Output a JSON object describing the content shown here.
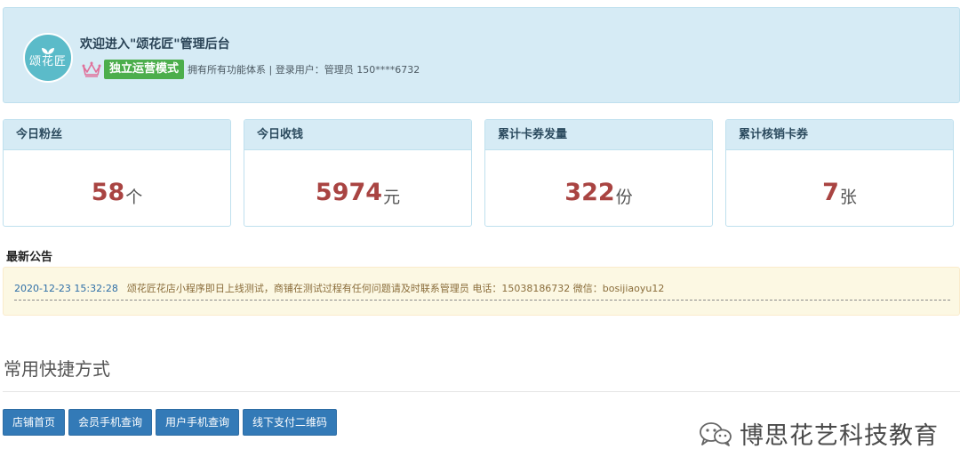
{
  "header": {
    "logo_text": "颂花匠",
    "welcome": "欢迎进入\"颂花匠\"管理后台",
    "mode_badge": "独立运营模式",
    "sub_info": "拥有所有功能体系 | 登录用户：管理员 150****6732"
  },
  "stats": [
    {
      "label": "今日粉丝",
      "value": "58",
      "unit": "个"
    },
    {
      "label": "今日收钱",
      "value": "5974",
      "unit": "元"
    },
    {
      "label": "累计卡券发量",
      "value": "322",
      "unit": "份"
    },
    {
      "label": "累计核销卡券",
      "value": "7",
      "unit": "张"
    }
  ],
  "notice": {
    "title": "最新公告",
    "time": "2020-12-23 15:32:28",
    "text": "颂花匠花店小程序即日上线测试，商铺在测试过程有任何问题请及时联系管理员 电话：15038186732 微信：bosijiaoyu12"
  },
  "shortcuts": {
    "title": "常用快捷方式",
    "buttons": [
      "店铺首页",
      "会员手机查询",
      "用户手机查询",
      "线下支付二维码"
    ]
  },
  "watermark": {
    "text": "博思花艺科技教育"
  },
  "colors": {
    "header_bg": "#d6ebf5",
    "badge_green": "#4cae4c",
    "stat_number": "#a94442",
    "notice_bg": "#fcf8e3",
    "button_blue": "#337ab7"
  },
  "icons": {
    "logo": "flower-logo-icon",
    "crown": "crown-icon",
    "watermark": "wechat-icon"
  }
}
